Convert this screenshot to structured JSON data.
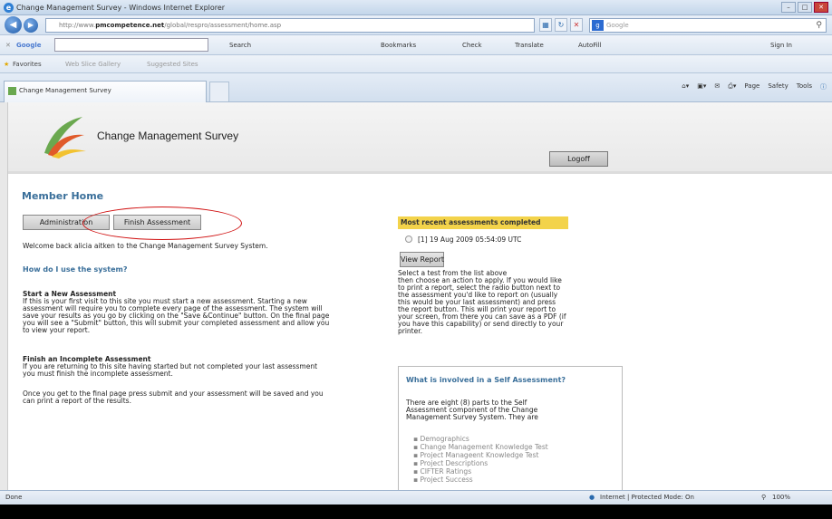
{
  "window": {
    "title": "Change Management Survey - Windows Internet Explorer"
  },
  "address": {
    "url_prefix": "http://www.",
    "url_domain": "pmcompetence.net",
    "url_path": "/global/respro/assessment/home.asp",
    "search_placeholder": "Google"
  },
  "google_toolbar": {
    "label": "Google",
    "search": "Search",
    "bookmarks": "Bookmarks",
    "check": "Check",
    "translate": "Translate",
    "autofill": "AutoFill",
    "signin": "Sign In"
  },
  "favorites": {
    "label": "Favorites",
    "web_slice": "Web Slice Gallery",
    "suggested": "Suggested Sites"
  },
  "tab": {
    "title": "Change Management Survey"
  },
  "commands": {
    "page": "Page",
    "safety": "Safety",
    "tools": "Tools"
  },
  "app": {
    "title": "Change Management Survey",
    "logoff": "Logoff"
  },
  "main": {
    "heading": "Member Home",
    "admin_button": "Administration",
    "finish_button": "Finish Assessment",
    "welcome": "Welcome back alicia aitken to the Change Management Survey System.",
    "how_heading": "How do I use the system?",
    "start_heading": "Start a New Assessment",
    "start_lines": [
      "If this is your first visit to this site you must start a new assessment. Starting a new",
      "assessment will require you to complete every page of the assessment. The system will",
      "save your results as you go by clicking on the \"Save &Continue\" button. On the final page",
      "you will see a \"Submit\" button, this will submit your completed assessment and allow you",
      "to view your report."
    ],
    "finish_heading": "Finish an Incomplete Assessment",
    "finish_lines": [
      "If you are returning to this site having started but not completed your last assessment",
      "you must finish the incomplete assessment."
    ],
    "final_lines": [
      "Once you get to the final page press submit and your assessment will be saved and you",
      "can print a report of the results."
    ]
  },
  "recent": {
    "heading": "Most recent assessments completed",
    "entry": "[1]  19 Aug 2009 05:54:09 UTC",
    "view_button": "View Report",
    "help_lines": [
      "Select a test from the list above",
      "then choose an action to apply. If you would like",
      "to print a report, select the radio button next to",
      "the assessment you'd like to report on (usually",
      "this would be your last assessment) and press",
      "the report button. This will print your report to",
      "your screen, from there you can save as a PDF (if",
      "you have this capability) or send directly to your",
      "printer."
    ]
  },
  "panel": {
    "title": "What is involved in a Self Assessment?",
    "intro_lines": [
      "There are eight (8) parts to the Self",
      "Assessment component of the Change",
      "Management Survey System. They are"
    ],
    "items": [
      "Demographics",
      "Change Management Knowledge Test",
      "Project Manageent Knowledge Test",
      "Project Descriptions",
      "CIFTER Ratings",
      "Project Success"
    ]
  },
  "status": {
    "left": "Done",
    "zone": "Internet | Protected Mode: On",
    "zoom": "100%"
  }
}
